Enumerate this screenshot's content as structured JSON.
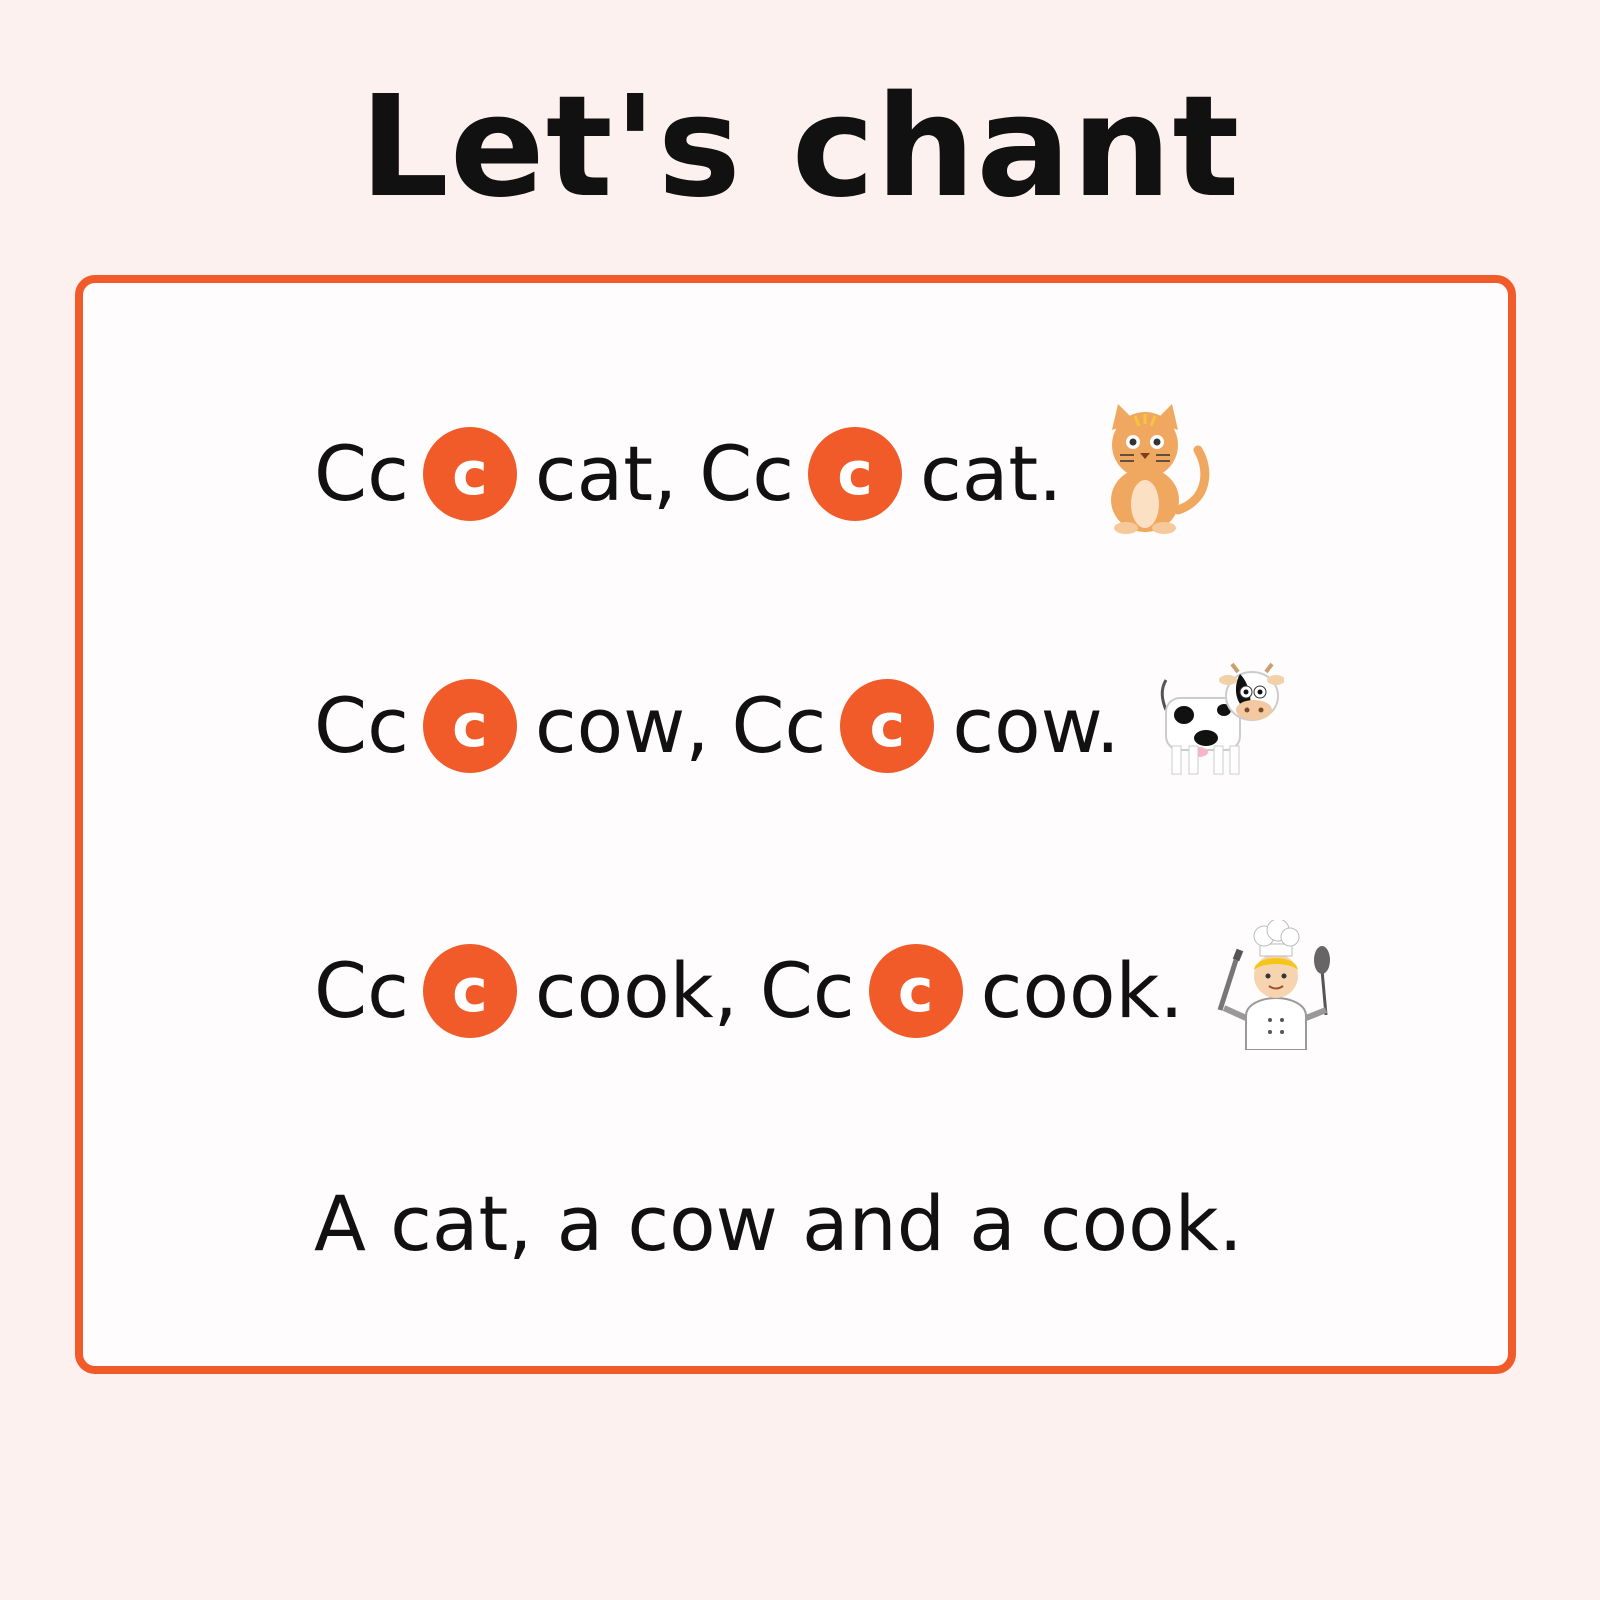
{
  "title": "Let's chant",
  "lines": [
    {
      "lead": "Cc",
      "sound": "c",
      "word1": "cat,",
      "lead2": "Cc",
      "sound2": "c",
      "word2": "cat.",
      "picture": "cat-icon"
    },
    {
      "lead": "Cc",
      "sound": "c",
      "word1": "cow,",
      "lead2": "Cc",
      "sound2": "c",
      "word2": "cow.",
      "picture": "cow-icon"
    },
    {
      "lead": "Cc",
      "sound": "c",
      "word1": "cook,",
      "lead2": "Cc",
      "sound2": "c",
      "word2": "cook.",
      "picture": "chef-icon"
    }
  ],
  "summary": "A cat, a cow and a cook.",
  "colors": {
    "accent": "#f15a29",
    "background": "#fcf1ee",
    "card": "#fefcfc",
    "text": "#111111"
  }
}
